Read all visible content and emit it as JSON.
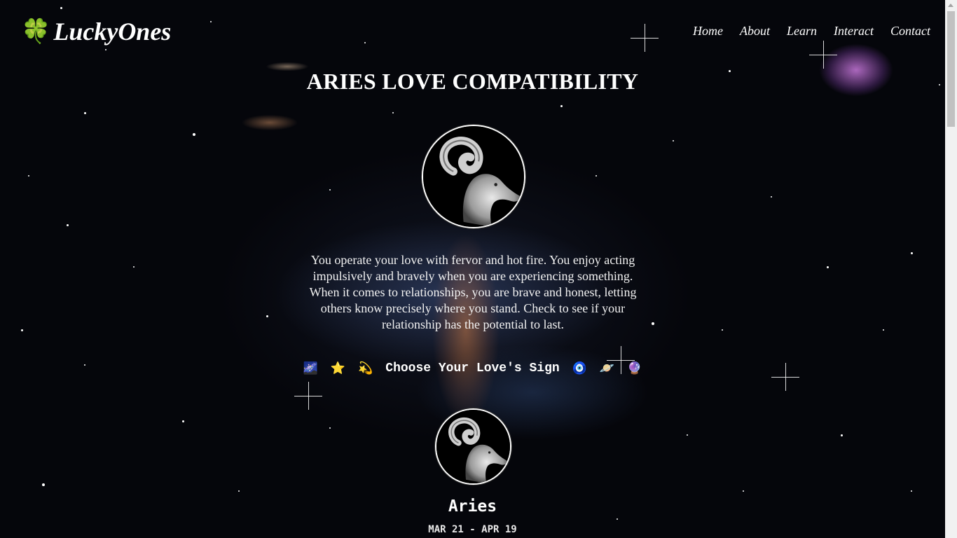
{
  "header": {
    "logo_icon": "four-leaf-clover-icon",
    "logo_glyph": "🍀",
    "logo_text": "LuckyOnes",
    "nav": [
      "Home",
      "About",
      "Learn",
      "Interact",
      "Contact"
    ]
  },
  "main": {
    "title": "ARIES LOVE COMPATIBILITY",
    "intro": "You operate your love with fervor and hot fire. You enjoy acting impulsively and bravely when you are experiencing something. When it comes to relationships, you are brave and honest, letting others know precisely where you stand. Check to see if your relationship has the potential to last.",
    "choose_label": "Choose Your Love's Sign",
    "choose_icons_left": [
      "🌌",
      "⭐",
      "💫"
    ],
    "choose_icons_right": [
      "🧿",
      "🪐",
      "🔮"
    ],
    "sign": {
      "name": "Aries",
      "dates": "MAR 21 - APR 19"
    }
  },
  "colors": {
    "background": "#05060b",
    "text": "#ffffff",
    "clover": "#2fb52f"
  }
}
